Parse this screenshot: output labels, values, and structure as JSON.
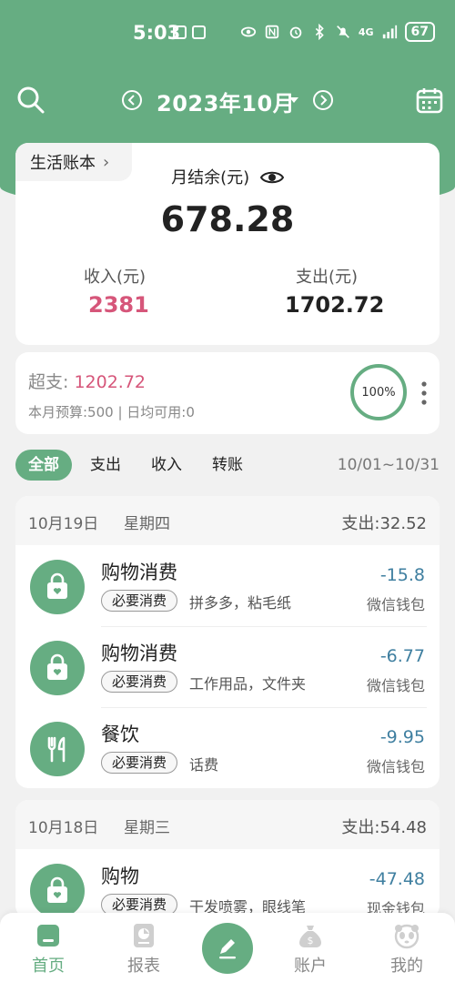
{
  "status_bar": {
    "time": "5:03",
    "network": "4G",
    "battery": "67"
  },
  "header": {
    "month_title": "2023年10月"
  },
  "summary": {
    "book_name": "生活账本",
    "balance_label": "月结余(元)",
    "balance_value": "678.28",
    "income_label": "收入(元)",
    "income_value": "2381",
    "expense_label": "支出(元)",
    "expense_value": "1702.72"
  },
  "budget": {
    "overspend_label": "超支:",
    "overspend_value": "1202.72",
    "subtitle": "本月预算:500 | 日均可用:0",
    "progress_text": "100%",
    "progress_percent": 100
  },
  "filters": {
    "tabs": [
      {
        "label": "全部"
      },
      {
        "label": "支出"
      },
      {
        "label": "收入"
      },
      {
        "label": "转账"
      }
    ],
    "active": "全部",
    "date_range": "10/01~10/31"
  },
  "groups": [
    {
      "date": "10月19日",
      "weekday": "星期四",
      "total": "支出:32.52",
      "items": [
        {
          "category": "购物消费",
          "tag": "必要消费",
          "note": "拼多多，粘毛纸",
          "amount": "-15.8",
          "account": "微信钱包",
          "icon": "shopping-bag-icon"
        },
        {
          "category": "购物消费",
          "tag": "必要消费",
          "note": "工作用品，文件夹",
          "amount": "-6.77",
          "account": "微信钱包",
          "icon": "shopping-bag-icon"
        },
        {
          "category": "餐饮",
          "tag": "必要消费",
          "note": "话费",
          "amount": "-9.95",
          "account": "微信钱包",
          "icon": "fork-knife-icon"
        }
      ]
    },
    {
      "date": "10月18日",
      "weekday": "星期三",
      "total": "支出:54.48",
      "items": [
        {
          "category": "购物",
          "tag": "必要消费",
          "note": "干发喷雾，眼线笔",
          "amount": "-47.48",
          "account": "现金钱包",
          "icon": "shopping-bag-icon"
        }
      ]
    }
  ],
  "nav": [
    {
      "label": "首页"
    },
    {
      "label": "报表"
    },
    {
      "label": "账户"
    },
    {
      "label": "我的"
    }
  ],
  "colors": {
    "brand": "#66ad82",
    "income": "#d6567a",
    "amount": "#3f7fa0"
  }
}
